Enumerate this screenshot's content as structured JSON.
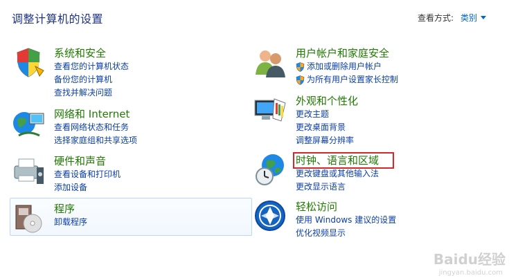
{
  "page": {
    "title": "调整计算机的设置",
    "view_by_label": "查看方式:",
    "view_by_value": "类别"
  },
  "categories_left": [
    {
      "title": "系统和安全",
      "links": [
        "查看您的计算机状态",
        "备份您的计算机",
        "查找并解决问题"
      ]
    },
    {
      "title": "网络和 Internet",
      "links": [
        "查看网络状态和任务",
        "选择家庭组和共享选项"
      ]
    },
    {
      "title": "硬件和声音",
      "links": [
        "查看设备和打印机",
        "添加设备"
      ]
    },
    {
      "title": "程序",
      "links": [
        "卸载程序"
      ]
    }
  ],
  "categories_right": [
    {
      "title": "用户帐户和家庭安全",
      "links": [
        "添加或删除用户帐户",
        "为所有用户设置家长控制"
      ]
    },
    {
      "title": "外观和个性化",
      "links": [
        "更改主题",
        "更改桌面背景",
        "调整屏幕分辨率"
      ]
    },
    {
      "title": "时钟、语言和区域",
      "links": [
        "更改键盘或其他输入法",
        "更改显示语言"
      ]
    },
    {
      "title": "轻松访问",
      "links": [
        "使用 Windows 建议的设置",
        "优化视频显示"
      ]
    }
  ],
  "watermark": {
    "text": "Baidu经验",
    "sub": "jingyan.baidu.com"
  },
  "colors": {
    "category_title": "#1f7a00",
    "link": "#0b3ea8",
    "highlight_border": "#d6262a"
  }
}
